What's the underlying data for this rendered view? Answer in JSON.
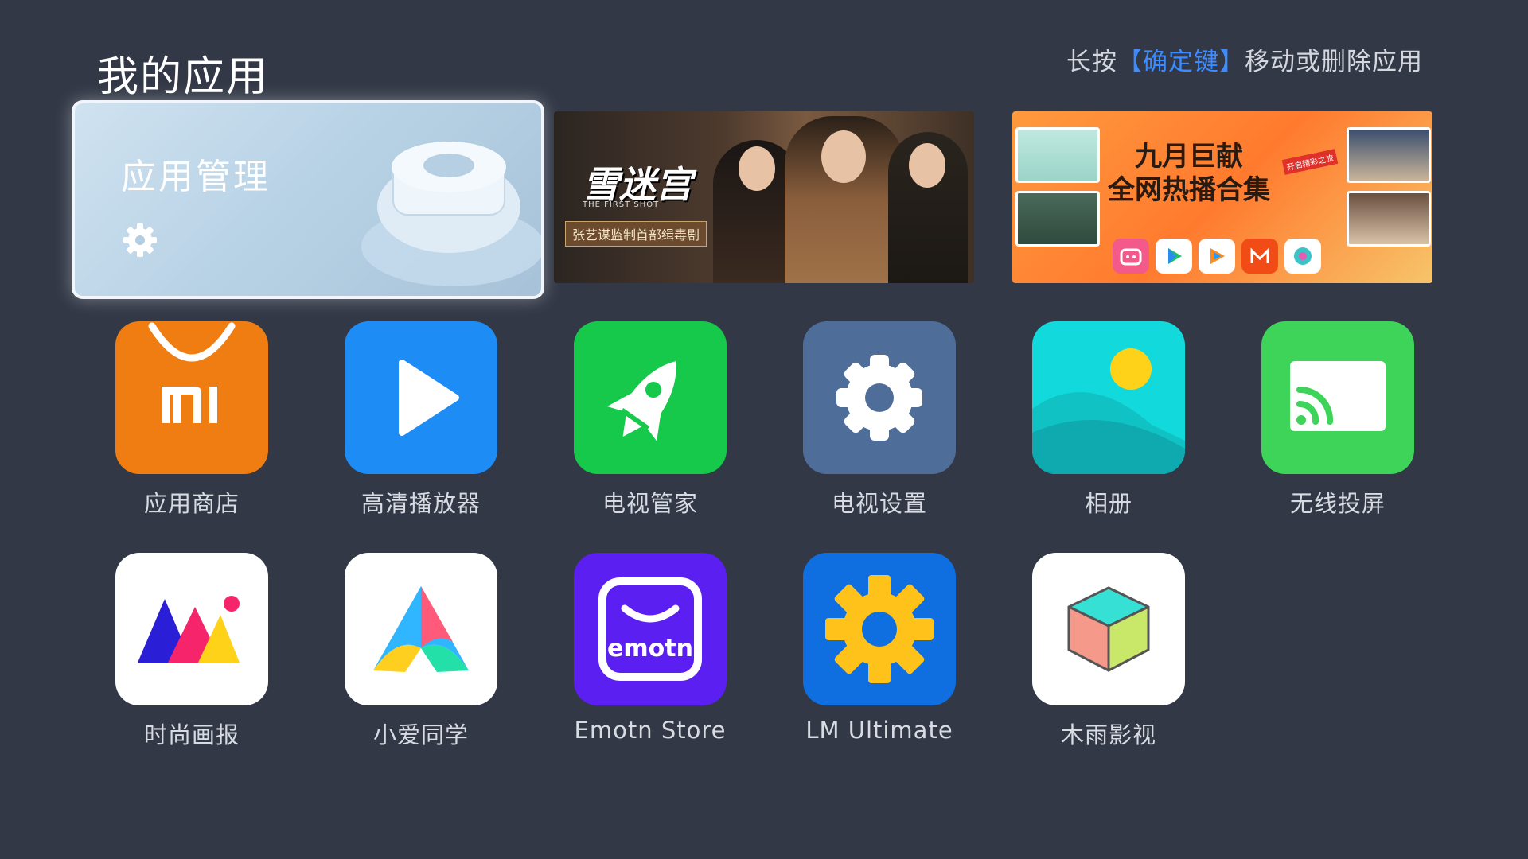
{
  "header": {
    "title": "我的应用",
    "hint_prefix": "长按",
    "hint_key": "【确定键】",
    "hint_suffix": "移动或删除应用"
  },
  "management_card": {
    "label": "应用管理"
  },
  "banners": [
    {
      "title": "雪迷宫",
      "subtitle": "THE FIRST SHOT",
      "tag": "张艺谋监制首部缉毒剧"
    },
    {
      "title_line1": "九月巨献",
      "title_line2": "全网热播合集",
      "badge": "开启精彩之旅"
    }
  ],
  "apps": [
    {
      "name": "应用商店",
      "icon": "mi-store-icon",
      "color": "#f07d12"
    },
    {
      "name": "高清播放器",
      "icon": "play-icon",
      "color": "#1e8cf5"
    },
    {
      "name": "电视管家",
      "icon": "rocket-icon",
      "color": "#16c94a"
    },
    {
      "name": "电视设置",
      "icon": "gear-icon",
      "color": "#4f6d99"
    },
    {
      "name": "相册",
      "icon": "gallery-icon",
      "color": "#12d9db"
    },
    {
      "name": "无线投屏",
      "icon": "cast-icon",
      "color": "#3ed45a"
    },
    {
      "name": "时尚画报",
      "icon": "fashion-icon",
      "color": "#ffffff"
    },
    {
      "name": "小爱同学",
      "icon": "xiaoai-icon",
      "color": "#ffffff"
    },
    {
      "name": "Emotn Store",
      "icon": "emotn-icon",
      "color": "#5b1ff2"
    },
    {
      "name": "LM Ultimate",
      "icon": "lm-gear-icon",
      "color": "#0f6fe0"
    },
    {
      "name": "木雨影视",
      "icon": "cube-icon",
      "color": "#ffffff"
    }
  ]
}
